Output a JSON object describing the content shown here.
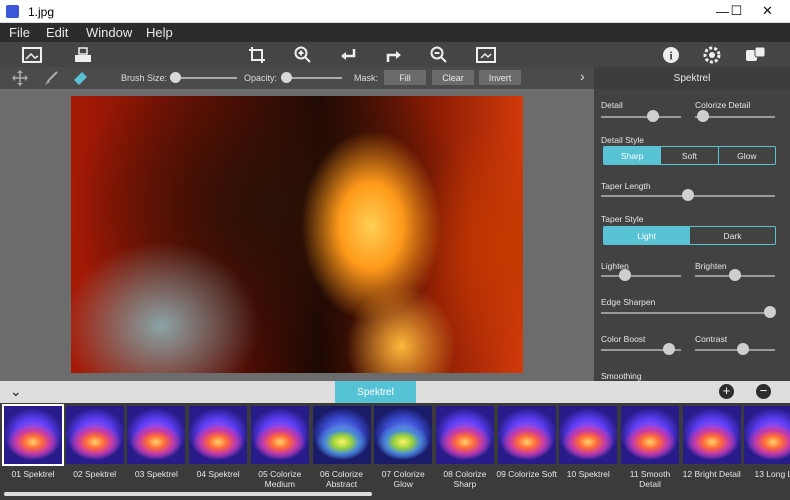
{
  "window": {
    "title": "1.jpg",
    "minimize": "—",
    "maximize": "☐",
    "close": "✕"
  },
  "menu": [
    "File",
    "Edit",
    "Window",
    "Help"
  ],
  "toolbar": {
    "icons": [
      "image-icon",
      "save-icon",
      "crop-icon",
      "zoom-in-icon",
      "undo-icon",
      "redo-icon",
      "zoom-out-icon",
      "fit-icon",
      "info-icon",
      "settings-icon",
      "random-icon"
    ]
  },
  "options": {
    "brush_size_label": "Brush Size:",
    "brush_size": 0.08,
    "opacity_label": "Opacity:",
    "opacity": 0.08,
    "mask_label": "Mask:",
    "fill": "Fill",
    "clear": "Clear",
    "invert": "Invert",
    "more": "›"
  },
  "panel": {
    "title": "Spektrel",
    "detail": {
      "label": "Detail",
      "value": 0.65
    },
    "colorize_detail": {
      "label": "Colorize Detail",
      "value": 0.1
    },
    "detail_style": {
      "label": "Detail Style",
      "options": [
        "Sharp",
        "Soft",
        "Glow"
      ],
      "selected": "Sharp"
    },
    "taper_length": {
      "label": "Taper Length",
      "value": 0.5
    },
    "taper_style": {
      "label": "Taper Style",
      "options": [
        "Light",
        "Dark"
      ],
      "selected": "Light"
    },
    "lighten": {
      "label": "Lighten",
      "value": 0.3
    },
    "brighten": {
      "label": "Brighten",
      "value": 0.5
    },
    "edge_sharpen": {
      "label": "Edge Sharpen",
      "value": 0.97
    },
    "color_boost": {
      "label": "Color Boost",
      "value": 0.85
    },
    "contrast": {
      "label": "Contrast",
      "value": 0.6
    },
    "smoothing": {
      "label": "Smoothing"
    }
  },
  "presets": {
    "tab": "Spektrel",
    "collapse": "⌄",
    "add": "+",
    "remove": "−",
    "items": [
      {
        "name": "01 Spektrel",
        "selected": true
      },
      {
        "name": "02 Spektrel"
      },
      {
        "name": "03 Spektrel"
      },
      {
        "name": "04 Spektrel"
      },
      {
        "name": "05 Colorize Medium"
      },
      {
        "name": "06 Colorize Abstract"
      },
      {
        "name": "07 Colorize Glow"
      },
      {
        "name": "08 Colorize Sharp"
      },
      {
        "name": "09 Colorize Soft"
      },
      {
        "name": "10 Spektrel"
      },
      {
        "name": "11 Smooth Detail"
      },
      {
        "name": "12 Bright Detail"
      },
      {
        "name": "13 Long L"
      }
    ]
  },
  "colors": {
    "accent": "#55c3d5",
    "panel": "#424242",
    "menubar": "#2c2c2c"
  }
}
